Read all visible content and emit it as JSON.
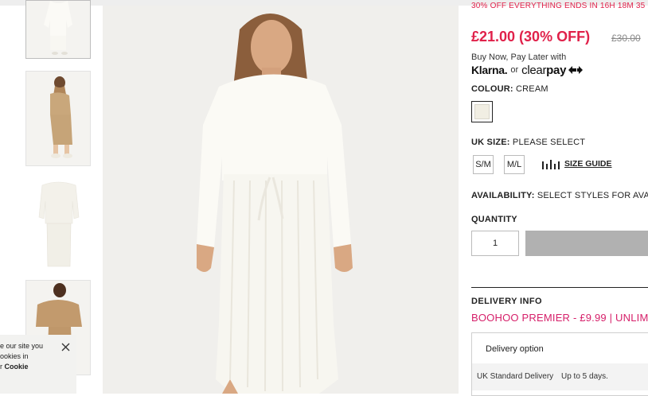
{
  "gallery": {
    "thumbnails": [
      "front-view",
      "back-view",
      "flat-lay",
      "camel-colourway"
    ]
  },
  "cookie": {
    "line1": "e our site you",
    "line2": "ookies in",
    "line3_prefix": "r",
    "line3_link": "Cookie"
  },
  "product": {
    "promo": "30% OFF EVERYTHING ENDS IN 16H 18M 35",
    "price": "£21.00 (30% OFF)",
    "old_price": "£30.00",
    "bnpl_text": "Buy Now, Pay Later with",
    "klarna": "Klarna.",
    "or": "or",
    "clearpay_part1": "clear",
    "clearpay_part2": "pay",
    "colour_label": "COLOUR:",
    "colour_value": "CREAM",
    "colour_swatch": "#f1eee3",
    "size_label": "UK SIZE:",
    "size_value": "PLEASE SELECT",
    "sizes": [
      "S/M",
      "M/L"
    ],
    "size_guide": "SIZE GUIDE",
    "availability_label": "AVAILABILITY:",
    "availability_value": "SELECT STYLES FOR AVA",
    "quantity_label": "QUANTITY",
    "quantity": "1",
    "accent_color": "#e0214a"
  },
  "delivery": {
    "title": "DELIVERY INFO",
    "premier": "BOOHOO PREMIER - £9.99 | UNLIMI",
    "option_header": "Delivery option",
    "rows": [
      {
        "method": "UK Standard Delivery",
        "time": "Up to 5 days."
      }
    ]
  }
}
